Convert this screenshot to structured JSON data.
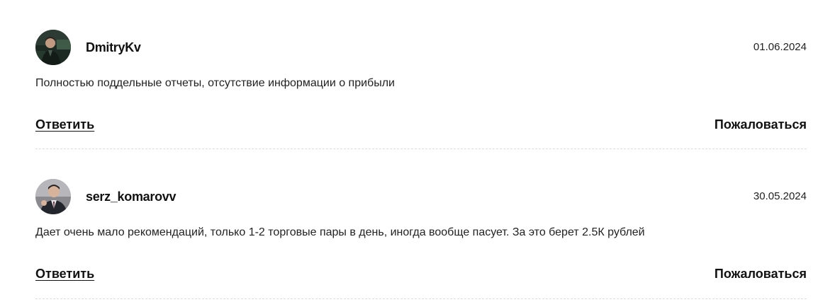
{
  "comments": [
    {
      "author": "DmitryKv",
      "date": "01.06.2024",
      "text": "Полностью поддельные отчеты, отсутствие информации о прибыли",
      "reply_label": "Ответить",
      "report_label": "Пожаловаться",
      "avatar_icon": "user-photo-icon"
    },
    {
      "author": "serz_komarovv",
      "date": "30.05.2024",
      "text": "Дает очень мало рекомендаций, только 1-2 торговые пары в день, иногда вообще пасует. За это берет 2.5К рублей",
      "reply_label": "Ответить",
      "report_label": "Пожаловаться",
      "avatar_icon": "user-photo-icon"
    }
  ]
}
